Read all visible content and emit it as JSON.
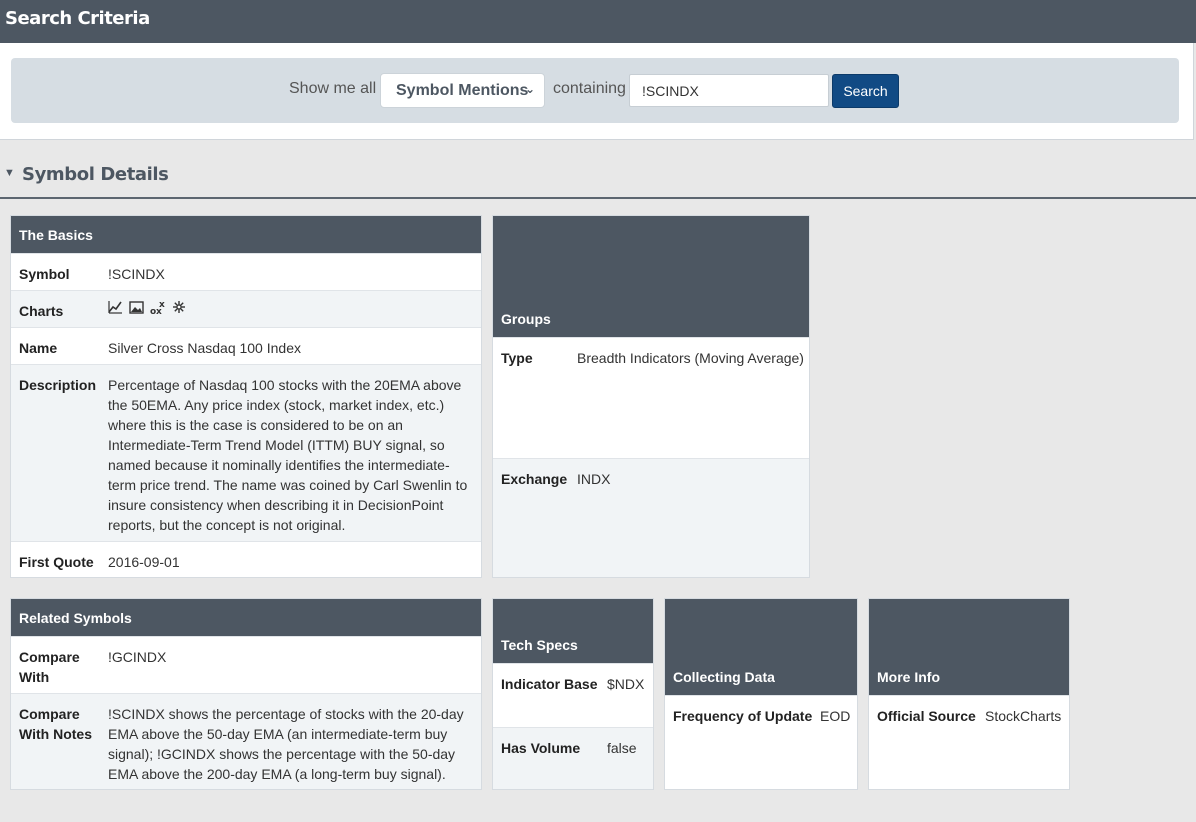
{
  "search": {
    "title": "Search Criteria",
    "show_label": "Show me all",
    "selected_type": "Symbol Mentions",
    "containing_label": "containing",
    "query": "!SCINDX",
    "button": "Search"
  },
  "details": {
    "title": "Symbol Details"
  },
  "basics": {
    "title": "The Basics",
    "symbol_label": "Symbol",
    "symbol": "!SCINDX",
    "charts_label": "Charts",
    "chart_icons": [
      "line-chart-icon",
      "image-chart-icon",
      "point-figure-icon",
      "seasonality-icon"
    ],
    "name_label": "Name",
    "name": "Silver Cross Nasdaq 100 Index",
    "description_label": "Description",
    "description": "Percentage of Nasdaq 100 stocks with the 20EMA above the 50EMA. Any price index (stock, market index, etc.) where this is the case is considered to be on an Intermediate-Term Trend Model (ITTM) BUY signal, so named because it nominally identifies the intermediate-term price trend. The name was coined by Carl Swenlin to insure consistency when describing it in DecisionPoint reports, but the concept is not original.",
    "first_quote_label": "First Quote",
    "first_quote": "2016-09-01"
  },
  "groups": {
    "title": "Groups",
    "type_label": "Type",
    "type": "Breadth Indicators (Moving Average)",
    "exchange_label": "Exchange",
    "exchange": "INDX"
  },
  "related": {
    "title": "Related Symbols",
    "compare_label": "Compare With",
    "compare": "!GCINDX",
    "notes_label": "Compare With Notes",
    "notes": "!SCINDX shows the percentage of stocks with the 20-day EMA above the 50-day EMA (an intermediate-term buy signal); !GCINDX shows the percentage with the 50-day EMA above the 200-day EMA (a long-term buy signal)."
  },
  "tech": {
    "title": "Tech Specs",
    "base_label": "Indicator Base",
    "base": "$NDX",
    "volume_label": "Has Volume",
    "volume": "false"
  },
  "collecting": {
    "title": "Collecting Data",
    "freq_label": "Frequency of Update",
    "freq": "EOD"
  },
  "more": {
    "title": "More Info",
    "source_label": "Official Source",
    "source": "StockCharts"
  }
}
